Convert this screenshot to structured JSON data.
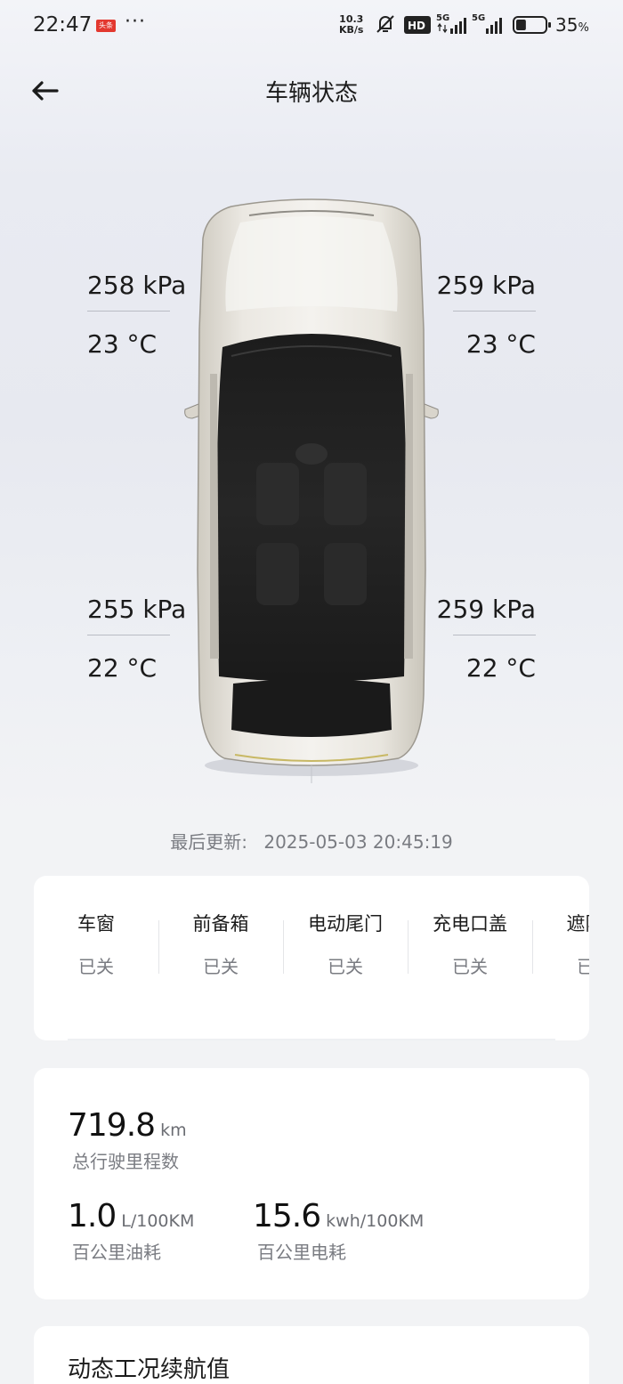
{
  "status_bar": {
    "time": "22:47",
    "app_badge": "头条",
    "more": "···",
    "net_speed_value": "10.3",
    "net_speed_unit": "KB/s",
    "signal_1_label": "5G",
    "signal_2_label": "5G",
    "hd_label": "HD",
    "battery_percent": "35",
    "battery_percent_sign": "%",
    "battery_level": 0.35
  },
  "header": {
    "title": "车辆状态"
  },
  "tires": {
    "front_left": {
      "pressure": "258 kPa",
      "temp": "23 °C"
    },
    "front_right": {
      "pressure": "259 kPa",
      "temp": "23 °C"
    },
    "rear_left": {
      "pressure": "255 kPa",
      "temp": "22 °C"
    },
    "rear_right": {
      "pressure": "259 kPa",
      "temp": "22 °C"
    }
  },
  "last_update": {
    "label": "最后更新:",
    "value": "2025-05-03 20:45:19"
  },
  "status_items": [
    {
      "label": "车窗",
      "value": "已关"
    },
    {
      "label": "前备箱",
      "value": "已关"
    },
    {
      "label": "电动尾门",
      "value": "已关"
    },
    {
      "label": "充电口盖",
      "value": "已关"
    },
    {
      "label": "遮阳帘",
      "value": "已关"
    }
  ],
  "stats": {
    "odometer": {
      "value": "719.8",
      "unit": "km",
      "caption": "总行驶里程数"
    },
    "fuel": {
      "value": "1.0",
      "unit": "L/100KM",
      "caption": "百公里油耗"
    },
    "power": {
      "value": "15.6",
      "unit": "kwh/100KM",
      "caption": "百公里电耗"
    }
  },
  "range": {
    "title": "动态工况续航值"
  },
  "colors": {
    "background": "#eef0f4",
    "card": "#ffffff",
    "text_primary": "#1b1b1b",
    "text_secondary": "#7a7c82",
    "badge_red": "#e3382f"
  }
}
